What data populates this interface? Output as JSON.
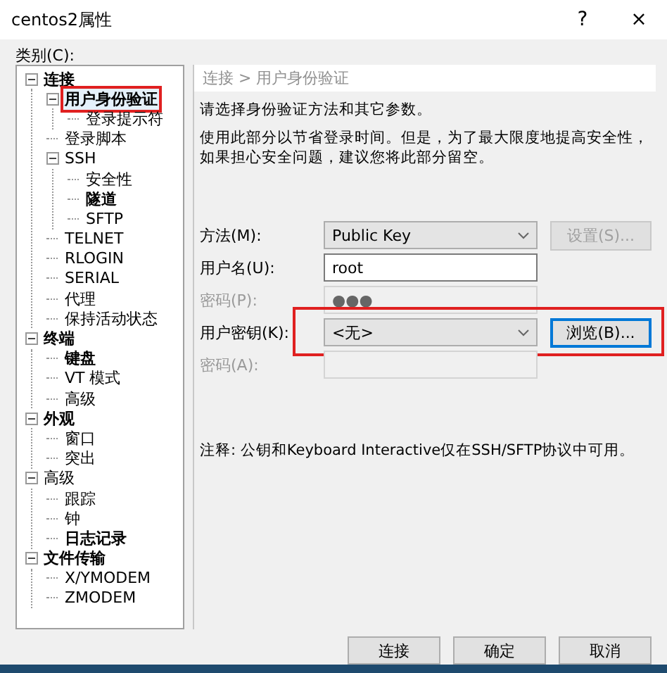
{
  "window": {
    "title": "centos2属性",
    "help": "?",
    "close": "×"
  },
  "category_label": "类别(C):",
  "tree": [
    {
      "label": "连接",
      "bold": true,
      "expanded": true,
      "selected": false,
      "highlighted": false,
      "children": [
        {
          "label": "用户身份验证",
          "bold": true,
          "expanded": true,
          "selected": true,
          "highlighted": true,
          "children": [
            {
              "label": "登录提示符",
              "bold": false,
              "selected": false,
              "highlighted": false
            }
          ]
        },
        {
          "label": "登录脚本",
          "bold": false,
          "selected": false,
          "highlighted": false
        },
        {
          "label": "SSH",
          "bold": false,
          "expanded": true,
          "selected": false,
          "highlighted": false,
          "children": [
            {
              "label": "安全性",
              "bold": false,
              "selected": false,
              "highlighted": false
            },
            {
              "label": "隧道",
              "bold": true,
              "selected": false,
              "highlighted": false
            },
            {
              "label": "SFTP",
              "bold": false,
              "selected": false,
              "highlighted": false
            }
          ]
        },
        {
          "label": "TELNET",
          "bold": false,
          "selected": false,
          "highlighted": false
        },
        {
          "label": "RLOGIN",
          "bold": false,
          "selected": false,
          "highlighted": false
        },
        {
          "label": "SERIAL",
          "bold": false,
          "selected": false,
          "highlighted": false
        },
        {
          "label": "代理",
          "bold": false,
          "selected": false,
          "highlighted": false
        },
        {
          "label": "保持活动状态",
          "bold": false,
          "selected": false,
          "highlighted": false
        }
      ]
    },
    {
      "label": "终端",
      "bold": true,
      "expanded": true,
      "selected": false,
      "highlighted": false,
      "children": [
        {
          "label": "键盘",
          "bold": true,
          "selected": false,
          "highlighted": false
        },
        {
          "label": "VT 模式",
          "bold": false,
          "selected": false,
          "highlighted": false
        },
        {
          "label": "高级",
          "bold": false,
          "selected": false,
          "highlighted": false
        }
      ]
    },
    {
      "label": "外观",
      "bold": true,
      "expanded": true,
      "selected": false,
      "highlighted": false,
      "children": [
        {
          "label": "窗口",
          "bold": false,
          "selected": false,
          "highlighted": false
        },
        {
          "label": "突出",
          "bold": false,
          "selected": false,
          "highlighted": false
        }
      ]
    },
    {
      "label": "高级",
      "bold": false,
      "expanded": true,
      "selected": false,
      "highlighted": false,
      "children": [
        {
          "label": "跟踪",
          "bold": false,
          "selected": false,
          "highlighted": false
        },
        {
          "label": "钟",
          "bold": false,
          "selected": false,
          "highlighted": false
        },
        {
          "label": "日志记录",
          "bold": true,
          "selected": false,
          "highlighted": false
        }
      ]
    },
    {
      "label": "文件传输",
      "bold": true,
      "expanded": true,
      "selected": false,
      "highlighted": false,
      "children": [
        {
          "label": "X/YMODEM",
          "bold": false,
          "selected": false,
          "highlighted": false
        },
        {
          "label": "ZMODEM",
          "bold": false,
          "selected": false,
          "highlighted": false
        }
      ]
    }
  ],
  "breadcrumb": "连接 > 用户身份验证",
  "descriptions": [
    "请选择身份验证方法和其它参数。",
    "使用此部分以节省登录时间。但是，为了最大限度地提高安全性，如果担心安全问题，建议您将此部分留空。"
  ],
  "form_rows": [
    {
      "kind": "select",
      "label": "方法(M):",
      "value": "Public Key",
      "disabled": false,
      "highlighted": false,
      "button": {
        "label": "设置(S)...",
        "disabled": true,
        "focused": false
      }
    },
    {
      "kind": "text",
      "label": "用户名(U):",
      "value": "root",
      "disabled": false,
      "highlighted": false
    },
    {
      "kind": "text",
      "label": "密码(P):",
      "value": "●●●",
      "disabled": true,
      "highlighted": false
    },
    {
      "kind": "select",
      "label": "用户密钥(K):",
      "value": "<无>",
      "disabled": false,
      "highlighted": true,
      "button": {
        "label": "浏览(B)...",
        "disabled": false,
        "focused": true
      }
    },
    {
      "kind": "text",
      "label": "密码(A):",
      "value": "",
      "disabled": true,
      "highlighted": false
    }
  ],
  "note": "注释: 公钥和Keyboard Interactive仅在SSH/SFTP协议中可用。",
  "buttons": [
    "连接",
    "确定",
    "取消"
  ]
}
